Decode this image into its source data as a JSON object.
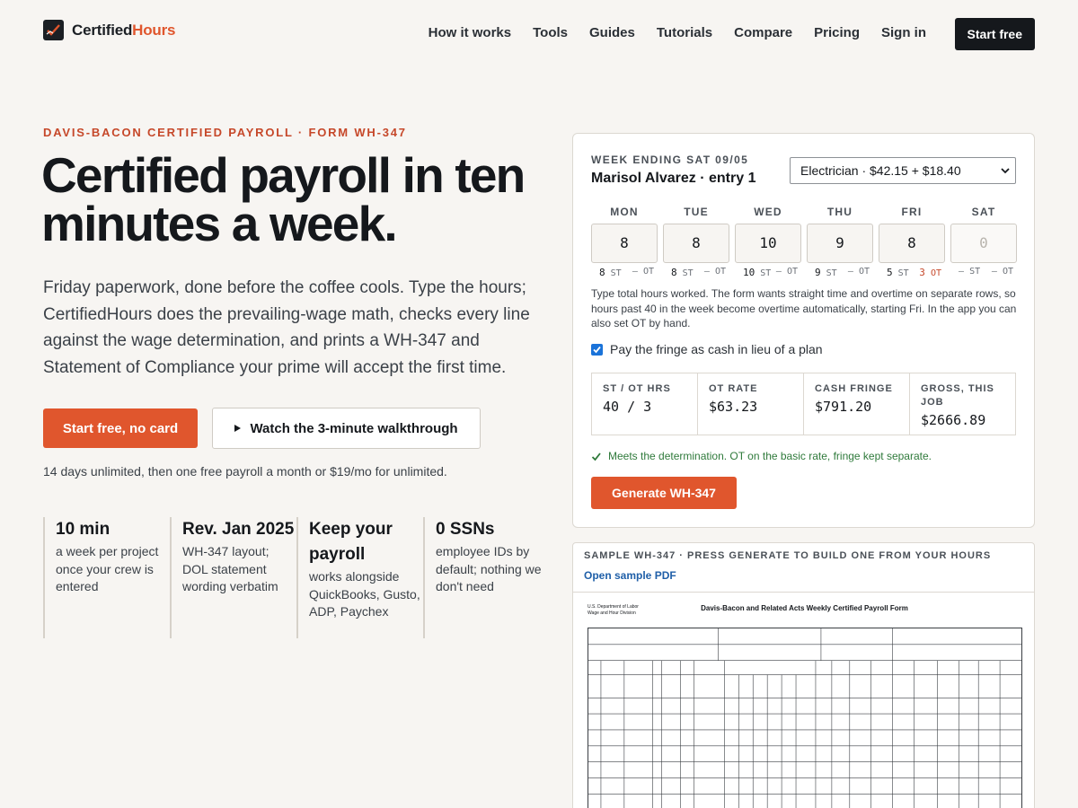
{
  "nav": {
    "brand": "Certified",
    "brand_accent": "Hours",
    "links": [
      "How it works",
      "Tools",
      "Guides",
      "Tutorials",
      "Compare",
      "Pricing",
      "Sign in"
    ],
    "cta": "Start free"
  },
  "hero": {
    "eyebrow": "DAVIS-BACON CERTIFIED PAYROLL · FORM WH-347",
    "headline": "Certified payroll in ten minutes a week.",
    "lede": "Friday paperwork, done before the coffee cools. Type the hours; CertifiedHours does the prevailing-wage math, checks every line against the wage determination, and prints a WH-347 and Statement of Compliance your prime will accept the first time.",
    "cta_primary": "Start free, no card",
    "cta_secondary": "Watch the 3-minute walkthrough",
    "fineprint": "14 days unlimited, then one free payroll a month or $19/mo for unlimited."
  },
  "stats": [
    {
      "title": "10 min",
      "text": "a week per project once your crew is entered"
    },
    {
      "title": "Rev. Jan 2025",
      "text": "WH-347 layout; DOL statement wording verbatim"
    },
    {
      "title": "Keep your payroll",
      "text": "works alongside QuickBooks, Gusto, ADP, Paychex"
    },
    {
      "title": "0 SSNs",
      "text": "employee IDs by default; nothing we don't need"
    }
  ],
  "card": {
    "week_label": "WEEK ENDING SAT 09/05",
    "worker": "Marisol Alvarez · entry 1",
    "classification": "Electrician · $42.15 + $18.40",
    "st_suffix": "ST",
    "ot_suffix": "OT",
    "days": [
      {
        "name": "MON",
        "hours": "8",
        "st": "8",
        "ot": "–"
      },
      {
        "name": "TUE",
        "hours": "8",
        "st": "8",
        "ot": "–"
      },
      {
        "name": "WED",
        "hours": "10",
        "st": "10",
        "ot": "–"
      },
      {
        "name": "THU",
        "hours": "9",
        "st": "9",
        "ot": "–"
      },
      {
        "name": "FRI",
        "hours": "8",
        "st": "5",
        "ot": "3"
      },
      {
        "name": "SAT",
        "hours": "",
        "placeholder": "0",
        "st": "–",
        "ot": "–"
      }
    ],
    "help": "Type total hours worked. The form wants straight time and overtime on separate rows, so hours past 40 in the week become overtime automatically, starting Fri. In the app you can also set OT by hand.",
    "fringe_label": "Pay the fringe as cash in lieu of a plan",
    "fringe_checked": true,
    "totals": [
      {
        "label": "ST / OT HRS",
        "value": "40 / 3"
      },
      {
        "label": "OT RATE",
        "value": "$63.23"
      },
      {
        "label": "CASH FRINGE",
        "value": "$791.20"
      },
      {
        "label": "GROSS, THIS JOB",
        "value": "$2666.89"
      }
    ],
    "check": "Meets the determination. OT on the basic rate, fringe kept separate.",
    "generate": "Generate WH-347"
  },
  "sample": {
    "title": "SAMPLE WH-347 · PRESS GENERATE TO BUILD ONE FROM YOUR HOURS",
    "link": "Open sample PDF",
    "doc_title": "Davis-Bacon and Related Acts Weekly Certified Payroll Form",
    "doc_agency_1": "U.S. Department of Labor",
    "doc_agency_2": "Wage and Hour Division"
  },
  "colors": {
    "accent": "#e0562d",
    "dark": "#15181c",
    "background": "#f7f5f2",
    "success": "#2f7a3b"
  }
}
